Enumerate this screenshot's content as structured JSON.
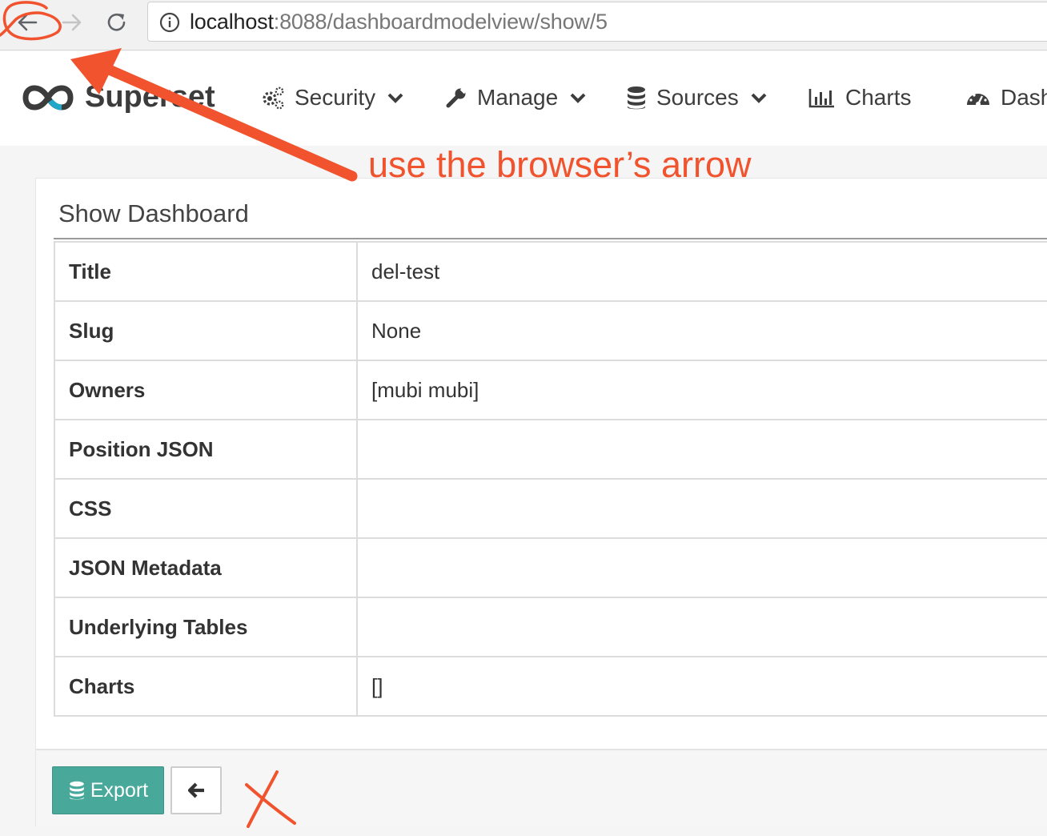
{
  "browser": {
    "url_host": "localhost",
    "url_rest": ":8088/dashboardmodelview/show/5"
  },
  "navbar": {
    "brand": "Superset",
    "items": [
      {
        "label": "Security",
        "icon": "gears-icon",
        "dropdown": true
      },
      {
        "label": "Manage",
        "icon": "wrench-icon",
        "dropdown": true
      },
      {
        "label": "Sources",
        "icon": "database-icon",
        "dropdown": true
      },
      {
        "label": "Charts",
        "icon": "bar-chart-icon",
        "dropdown": false
      },
      {
        "label": "Dash",
        "icon": "dashboard-icon",
        "dropdown": false
      }
    ]
  },
  "panel": {
    "title": "Show Dashboard",
    "rows": [
      {
        "label": "Title",
        "value": "del-test"
      },
      {
        "label": "Slug",
        "value": "None"
      },
      {
        "label": "Owners",
        "value": "[mubi mubi]"
      },
      {
        "label": "Position JSON",
        "value": ""
      },
      {
        "label": "CSS",
        "value": ""
      },
      {
        "label": "JSON Metadata",
        "value": ""
      },
      {
        "label": "Underlying Tables",
        "value": ""
      },
      {
        "label": "Charts",
        "value": "[]"
      }
    ],
    "export_label": "Export"
  },
  "annotation": {
    "text": "use the browser’s arrow",
    "color": "#f0532d"
  },
  "colors": {
    "export_button": "#48a89a",
    "annotation": "#f0532d"
  }
}
